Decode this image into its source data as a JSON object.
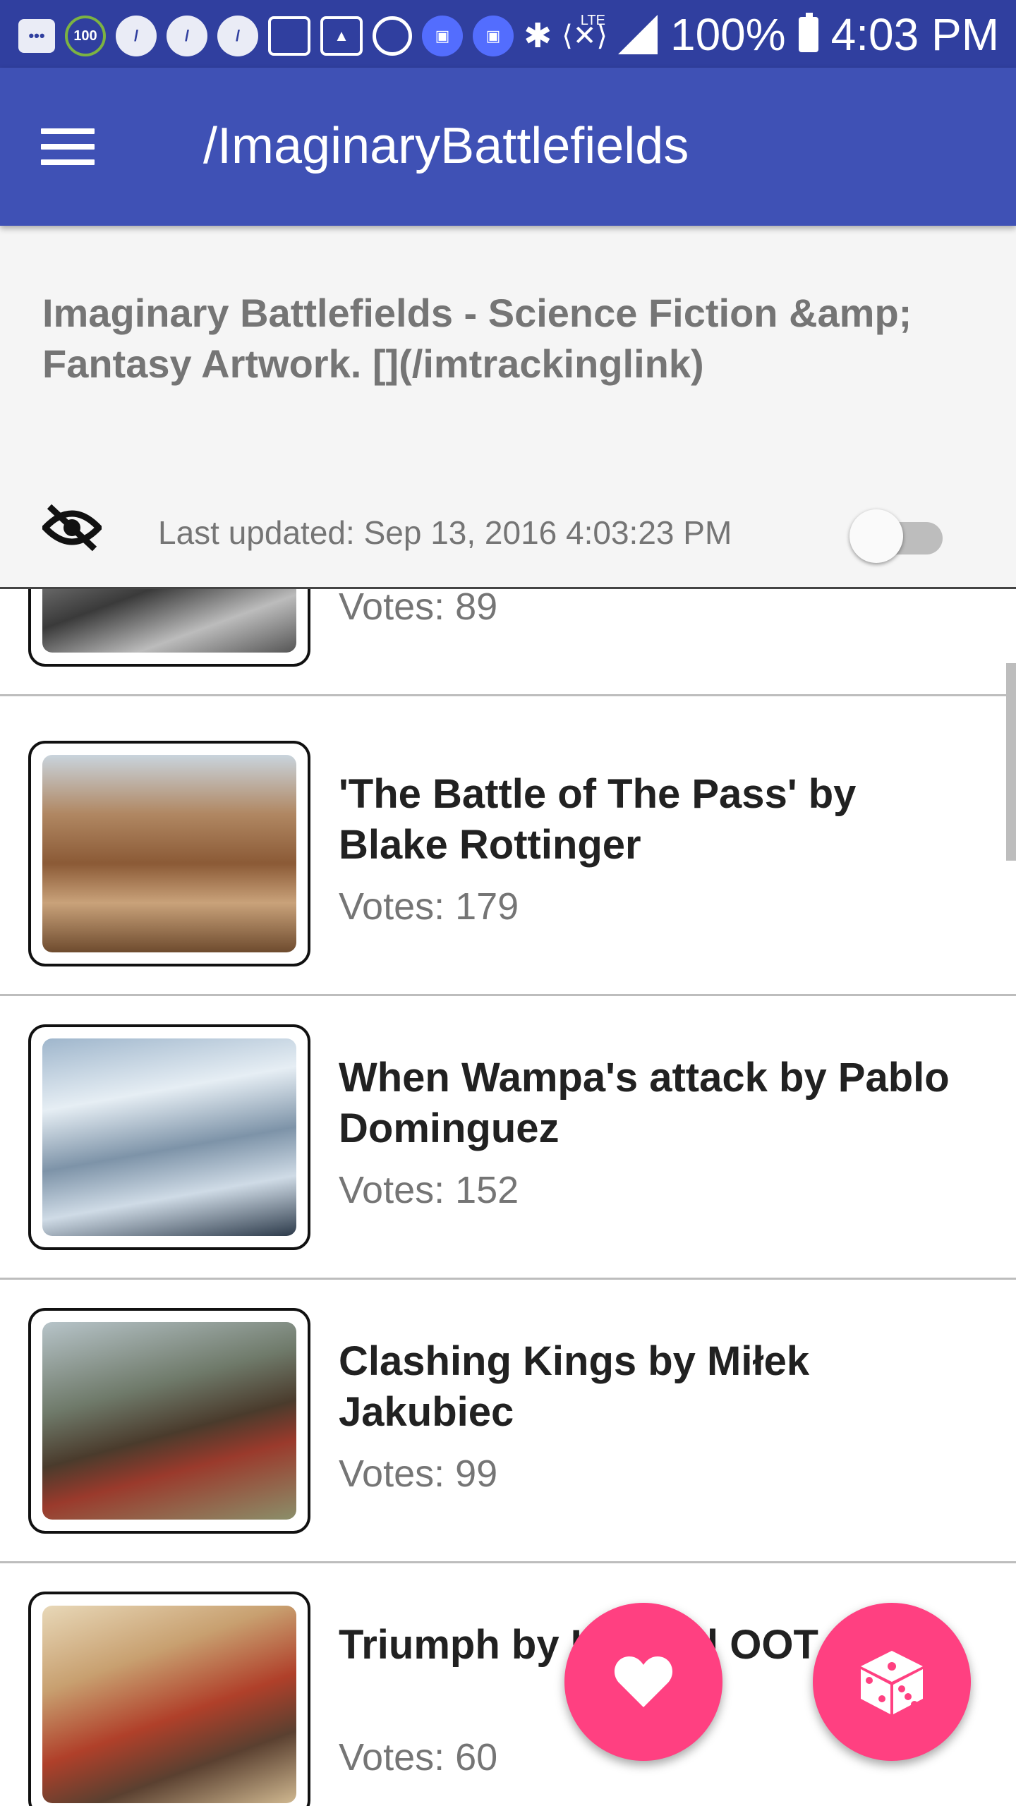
{
  "status_bar": {
    "battery": "100%",
    "time": "4:03 PM",
    "network": "LTE",
    "icons": [
      "chat-icon",
      "gauge-100-icon",
      "app-icon",
      "app-icon",
      "app-icon",
      "cleaner-icon",
      "gallery-icon",
      "sync-icon",
      "android-icon",
      "android-icon",
      "bluetooth-icon",
      "vibrate-icon",
      "signal-icon",
      "battery-icon"
    ],
    "gauge_label": "100"
  },
  "appbar": {
    "title": "/ImaginaryBattlefields",
    "color": "#3F51B5"
  },
  "header": {
    "description": "Imaginary Battlefields - Science Fiction &amp; Fantasy Artwork. [](/imtrackinglink)",
    "last_updated": "Last updated: Sep 13, 2016 4:03:23 PM",
    "toggle_on": false
  },
  "posts": [
    {
      "title": "",
      "votes": "Votes: 89"
    },
    {
      "title": "'The Battle of The Pass' by Blake Rottinger",
      "votes": "Votes: 179"
    },
    {
      "title": "When Wampa's attack by Pablo Dominguez",
      "votes": "Votes: 152"
    },
    {
      "title": "Clashing Kings by Miłek Jakubiec",
      "votes": "Votes: 99"
    },
    {
      "title": "Triumph by Hinchel OOT Studio",
      "votes": "Votes: 60"
    }
  ],
  "fabs": {
    "favorite_icon": "heart-icon",
    "random_icon": "dice-icon",
    "color": "#FF4081"
  }
}
